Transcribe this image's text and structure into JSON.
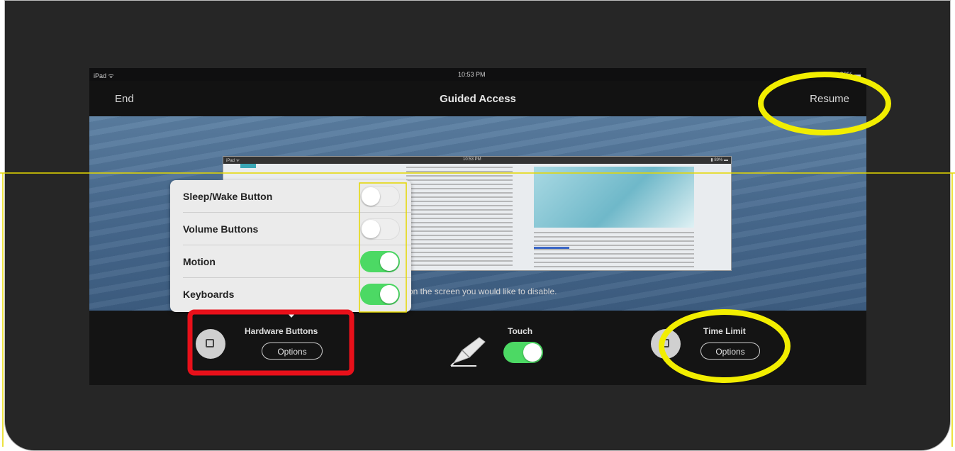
{
  "status_bar": {
    "carrier": "iPad ᯤ",
    "time": "10:53 PM",
    "battery": "▮ 89% ▬"
  },
  "nav": {
    "end_label": "End",
    "title": "Guided Access",
    "resume_label": "Resume"
  },
  "background_app": {
    "status_time": "10:53 PM",
    "carrier": "iPad ᯤ",
    "battery": "▮ 89% ▬"
  },
  "hint_text": "on the screen you would like to disable.",
  "hardware_options": {
    "items": [
      {
        "label": "Sleep/Wake Button",
        "enabled": false
      },
      {
        "label": "Volume Buttons",
        "enabled": false
      },
      {
        "label": "Motion",
        "enabled": true
      },
      {
        "label": "Keyboards",
        "enabled": true
      }
    ]
  },
  "toolbar": {
    "hardware_buttons_label": "Hardware Buttons",
    "hardware_options_label": "Options",
    "touch_label": "Touch",
    "touch_enabled": true,
    "time_limit_label": "Time Limit",
    "time_limit_options_label": "Options"
  },
  "annotation_colors": {
    "yellow": "#f2ee00",
    "red": "#e8101a",
    "highlight_line": "#e5d800",
    "toggle_on": "#4cd964"
  }
}
